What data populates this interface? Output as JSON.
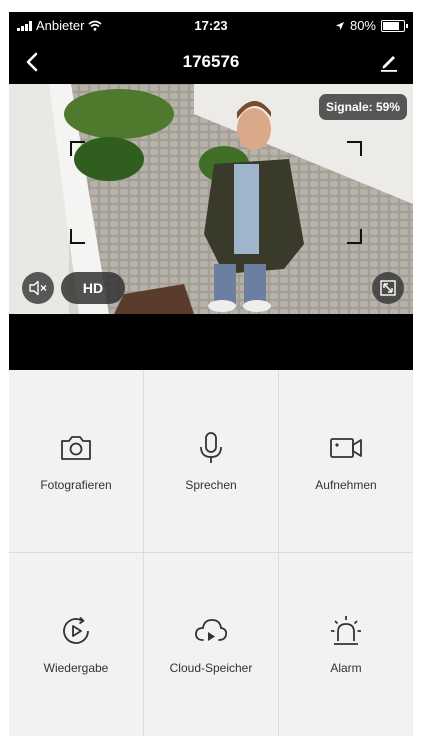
{
  "status_bar": {
    "carrier": "Anbieter",
    "time": "17:23",
    "battery": "80%",
    "battery_level": 0.8
  },
  "nav": {
    "title": "176576",
    "back_icon": "chevron-left-icon",
    "edit_icon": "pencil-icon"
  },
  "video": {
    "signal_label": "Signale: 59%",
    "quality_label": "HD",
    "mute_icon": "speaker-muted-icon",
    "fullscreen_icon": "fullscreen-icon"
  },
  "actions": [
    {
      "label": "Fotografieren",
      "icon": "camera-icon"
    },
    {
      "label": "Sprechen",
      "icon": "microphone-icon"
    },
    {
      "label": "Aufnehmen",
      "icon": "video-camera-icon"
    },
    {
      "label": "Wiedergabe",
      "icon": "playback-icon"
    },
    {
      "label": "Cloud-Speicher",
      "icon": "cloud-play-icon"
    },
    {
      "label": "Alarm",
      "icon": "siren-icon"
    }
  ],
  "colors": {
    "bar_background": "#000000",
    "panel_background": "#f2f2f2",
    "icon_color": "#333333"
  }
}
